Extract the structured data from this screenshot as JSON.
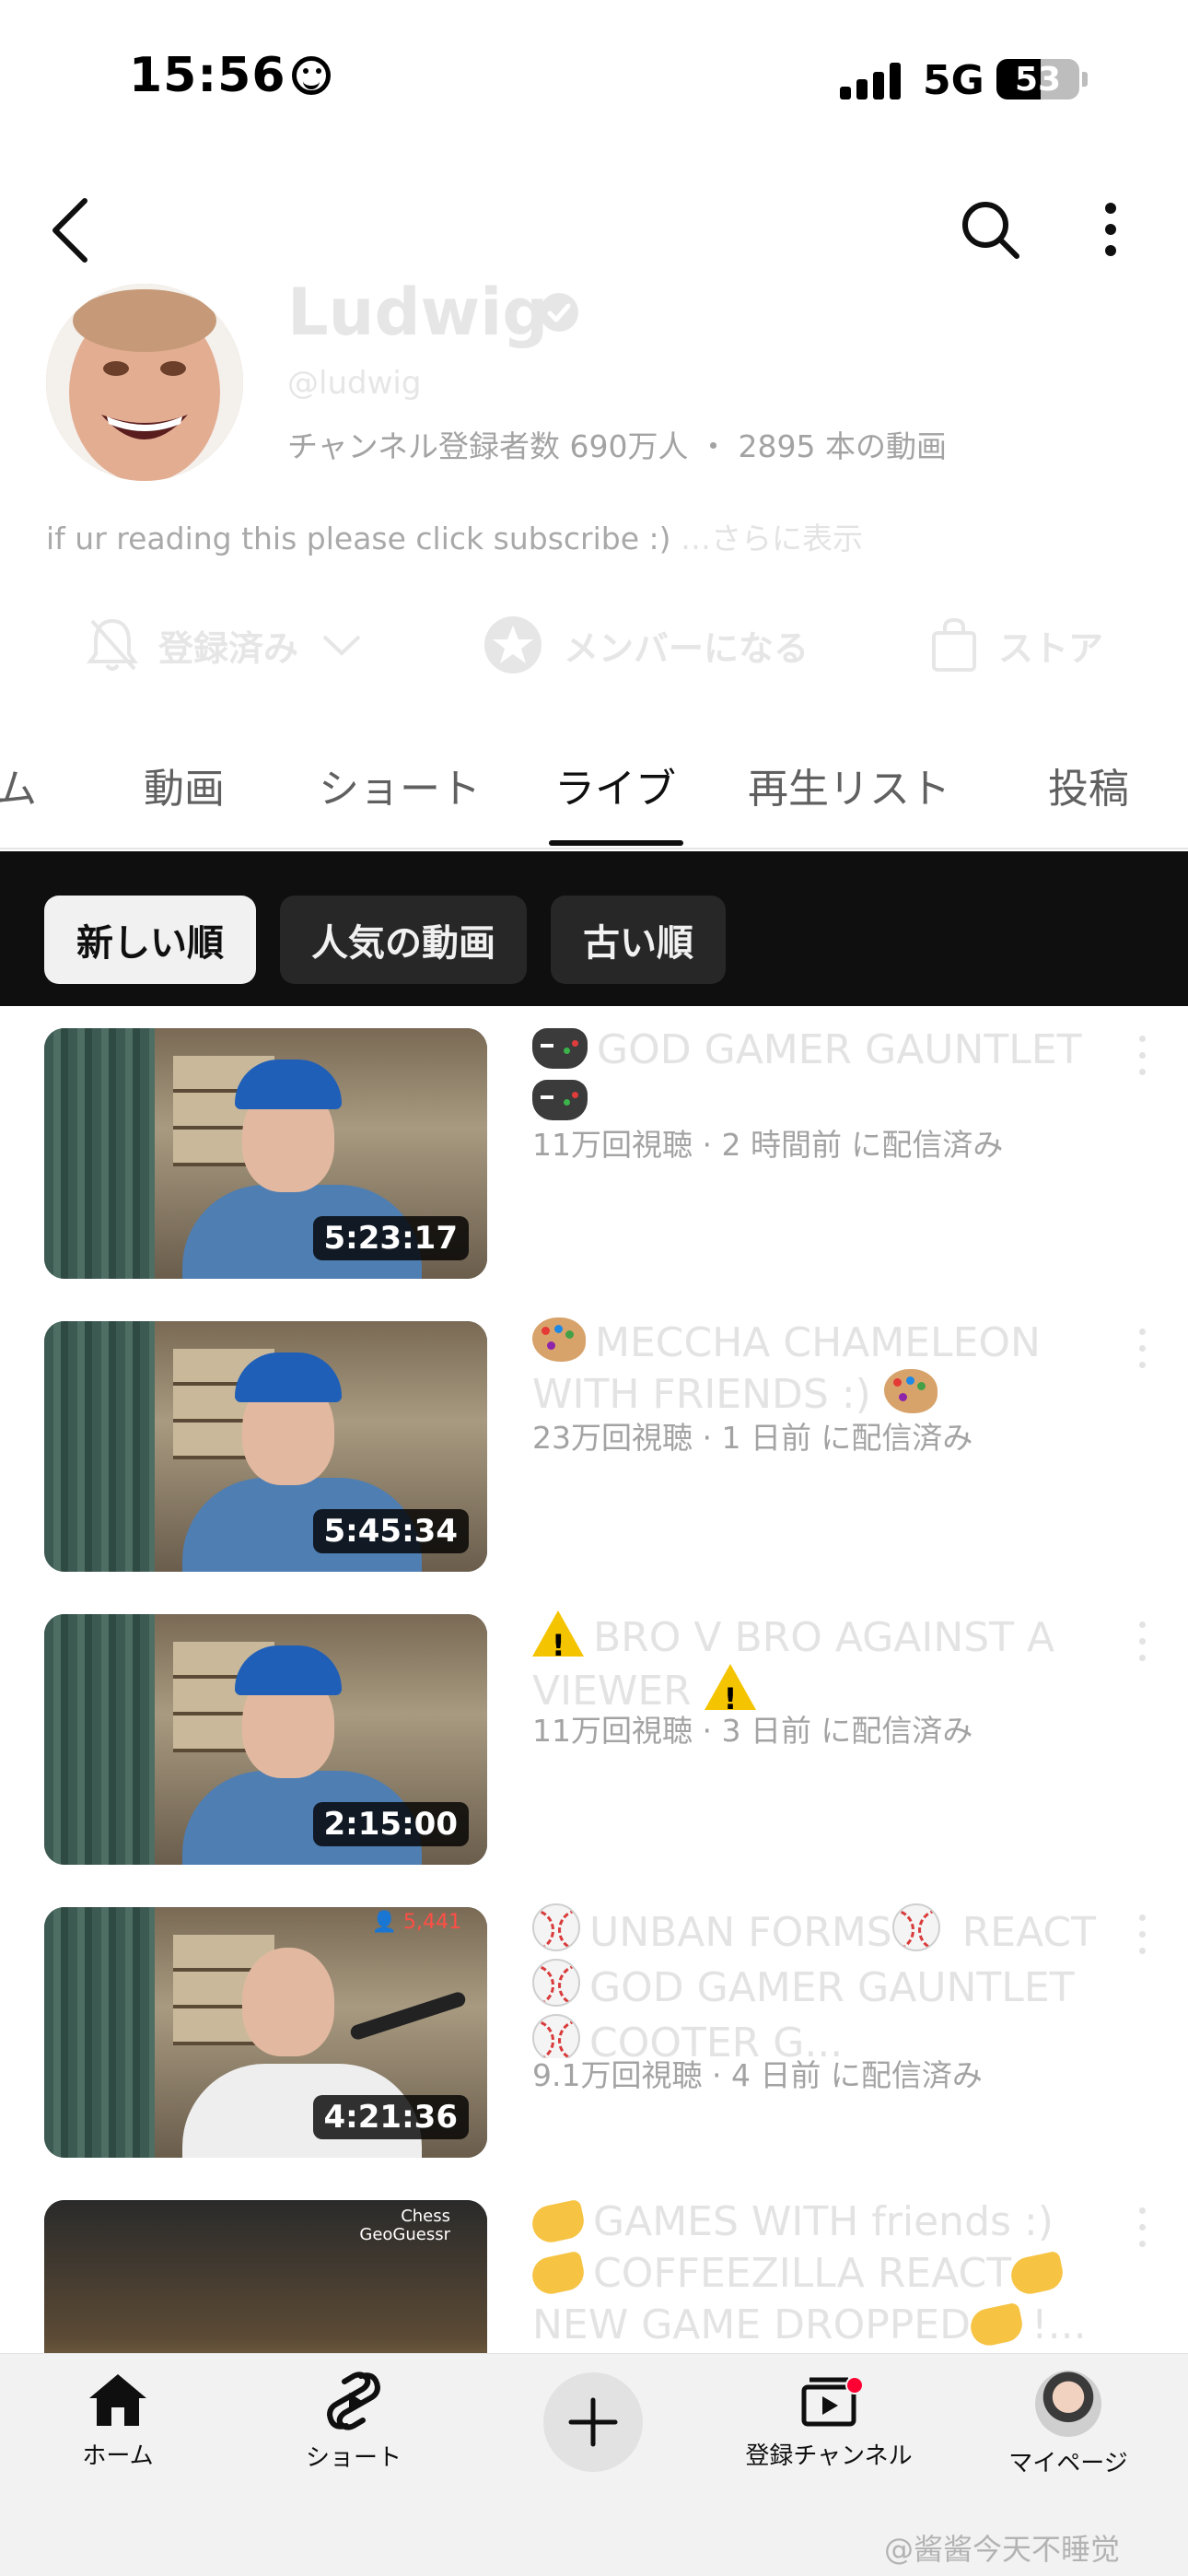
{
  "status_bar": {
    "time": "15:56",
    "network": "5G",
    "battery_level": "53",
    "battery_fraction": 0.53
  },
  "channel": {
    "name": "Ludwig",
    "handle": "@ludwig",
    "stats": "チャンネル登録者数 690万人 ・ 2895 本の動画",
    "description": "if ur reading this please click subscribe :)",
    "description_more": "…さらに表示"
  },
  "actions": {
    "subscribed_label": "登録済み",
    "join_label": "メンバーになる",
    "store_label": "ストア"
  },
  "tabs": [
    {
      "label": "ム"
    },
    {
      "label": "動画"
    },
    {
      "label": "ショート"
    },
    {
      "label": "ライブ",
      "active": true
    },
    {
      "label": "再生リスト"
    },
    {
      "label": "投稿"
    }
  ],
  "filters": [
    {
      "label": "新しい順",
      "active": true
    },
    {
      "label": "人気の動画"
    },
    {
      "label": "古い順"
    }
  ],
  "videos": [
    {
      "title_emoji": "game-controller-icon",
      "title": "GOD GAMER GAUNTLET",
      "duration": "5:23:17",
      "meta": "11万回視聴 · 2 時間前 に配信済み"
    },
    {
      "title_emoji": "palette-icon",
      "title": "MECCHA CHAMELEON WITH FRIENDS :)",
      "duration": "5:45:34",
      "meta": "23万回視聴 · 1 日前 に配信済み"
    },
    {
      "title_emoji": "warning-icon",
      "title": "BRO V BRO AGAINST A VIEWER",
      "duration": "2:15:00",
      "meta": "11万回視聴 · 3 日前 に配信済み"
    },
    {
      "title_emoji": "baseball-icon",
      "title_parts": [
        "UNBAN FORMS",
        "REACT",
        "GOD GAMER GAUNTLET",
        "COOTER G..."
      ],
      "duration": "4:21:36",
      "live_count": "5,441",
      "meta": "9.1万回視聴 · 4 日前 に配信済み"
    },
    {
      "title_emoji": "pinching-hand-icon",
      "title_parts": [
        "GAMES WITH friends :)",
        "COFFEEZILLA REACT",
        "NEW GAME DROPPED",
        "!..."
      ],
      "thumb_tag": "Chess\nGeoGuessr"
    }
  ],
  "bottom_nav": {
    "home_label": "ホーム",
    "shorts_label": "ショート",
    "subscriptions_label": "登録チャンネル",
    "you_label": "マイページ"
  },
  "watermark": "@酱酱今天不睡觉",
  "colors": {
    "filter_bar_bg": "#0f0f0f",
    "chip_active_bg": "#f1f1f1",
    "chip_bg": "#272727",
    "notification_dot": "#ff0033"
  }
}
